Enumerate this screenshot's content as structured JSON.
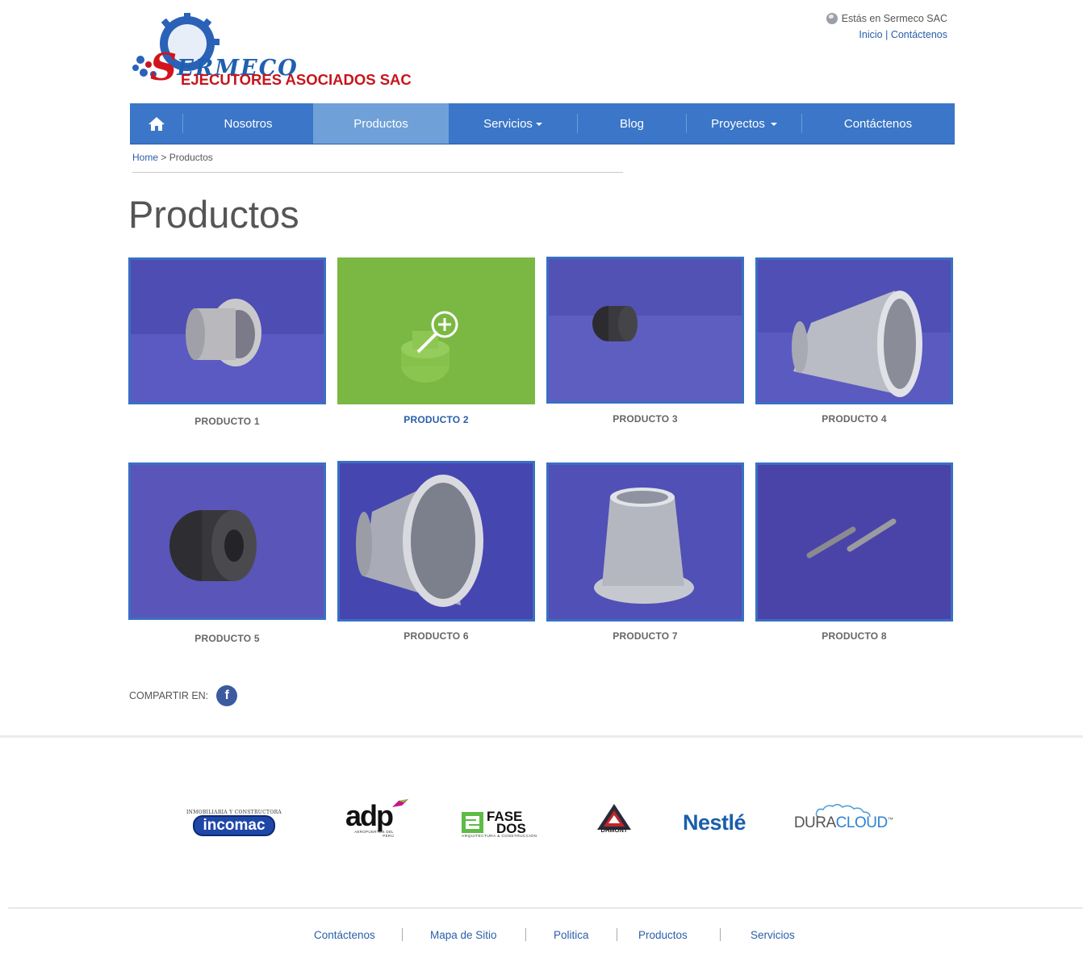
{
  "brand": {
    "name": "SERMECO",
    "tagline": "EJECUTORES ASOCIADOS SAC"
  },
  "top_right": {
    "location_text": "Estás en Sermeco SAC",
    "links": [
      "Inicio",
      "Contáctenos"
    ],
    "separator": "|"
  },
  "nav": {
    "home_icon": "home-icon",
    "items": [
      {
        "label": "Nosotros",
        "active": false,
        "dropdown": false
      },
      {
        "label": "Productos",
        "active": true,
        "dropdown": false
      },
      {
        "label": "Servicios",
        "active": false,
        "dropdown": true
      },
      {
        "label": "Blog",
        "active": false,
        "dropdown": false
      },
      {
        "label": "Proyectos",
        "active": false,
        "dropdown": true
      },
      {
        "label": "Contáctenos",
        "active": false,
        "dropdown": false
      }
    ],
    "bar_color": "#3b76c8",
    "active_color": "#6fa0d8"
  },
  "breadcrumb": {
    "home": "Home",
    "separator": ">",
    "current": "Productos"
  },
  "page_title": "Productos",
  "products": [
    {
      "label": "PRODUCTO 1"
    },
    {
      "label": "PRODUCTO 2"
    },
    {
      "label": "PRODUCTO 3"
    },
    {
      "label": "PRODUCTO 4"
    },
    {
      "label": "PRODUCTO 5"
    },
    {
      "label": "PRODUCTO 6"
    },
    {
      "label": "PRODUCTO 7"
    },
    {
      "label": "PRODUCTO 8"
    }
  ],
  "share": {
    "label": "COMPARTIR EN:",
    "icon": "facebook-icon",
    "glyph": "f"
  },
  "clients": {
    "incomac": {
      "small": "INMOBILIARIA Y CONSTRUCTORA",
      "name": "incomac"
    },
    "adp": {
      "name": "adp",
      "sub": "AEROPUERTOS DEL PERÚ"
    },
    "fasedos": {
      "line1": "FASE",
      "line2": "DOS",
      "sub": "ARQUITECTURA & CONSTRUCCIÓN"
    },
    "dhmont": {
      "name": "DHMONT"
    },
    "nestle": {
      "name": "Nestlé"
    },
    "duracloud": {
      "part1": "DURA",
      "part2": "CLOUD",
      "tm": "™"
    }
  },
  "footer": {
    "links": [
      "Contáctenos",
      "Mapa de Sitio",
      "Politica",
      "Productos",
      "Servicios"
    ]
  }
}
